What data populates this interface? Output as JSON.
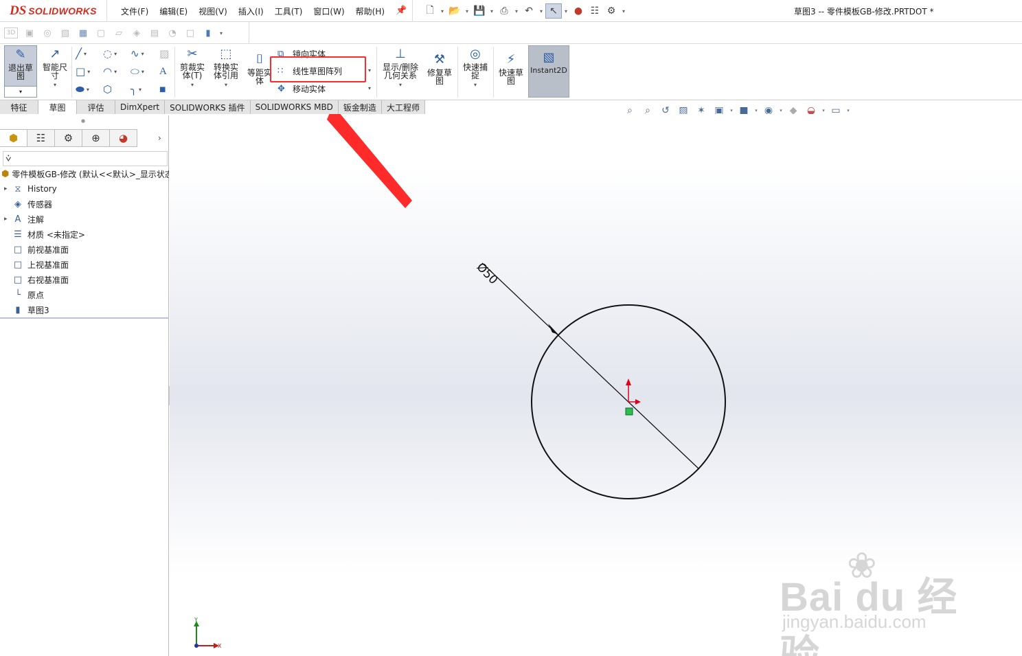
{
  "app": {
    "brand_ds": "DS",
    "brand_name": "SOLIDWORKS",
    "document_title": "草图3 -- 零件模板GB-修改.PRTDOT *"
  },
  "menu": [
    "文件(F)",
    "编辑(E)",
    "视图(V)",
    "插入(I)",
    "工具(T)",
    "窗口(W)",
    "帮助(H)"
  ],
  "ribbon": {
    "exit_sketch": "退出草图",
    "smart_dim": "智能尺寸",
    "trim": "剪裁实体(T)",
    "convert": "转换实体引用",
    "offset": "等距实体",
    "mirror": "镜向实体",
    "linear_pattern": "线性草图阵列",
    "move": "移动实体",
    "display_relations": "显示/删除几何关系",
    "repair": "修复草图",
    "quick_snap": "快速捕捉",
    "rapid_sketch": "快速草图",
    "instant2d": "Instant2D"
  },
  "tabs": [
    "特征",
    "草图",
    "评估",
    "DimXpert",
    "SOLIDWORKS 插件",
    "SOLIDWORKS MBD",
    "钣金制造",
    "大工程师"
  ],
  "active_tab": "草图",
  "tree": {
    "root": "零件模板GB-修改  (默认<<默认>_显示状态",
    "items": [
      {
        "label": "History",
        "icon": "history-icon",
        "expandable": true
      },
      {
        "label": "传感器",
        "icon": "sensor-icon",
        "expandable": false
      },
      {
        "label": "注解",
        "icon": "annotation-icon",
        "expandable": true
      },
      {
        "label": "材质 <未指定>",
        "icon": "material-icon",
        "expandable": false
      },
      {
        "label": "前视基准面",
        "icon": "plane-icon",
        "expandable": false
      },
      {
        "label": "上视基准面",
        "icon": "plane-icon",
        "expandable": false
      },
      {
        "label": "右视基准面",
        "icon": "plane-icon",
        "expandable": false
      },
      {
        "label": "原点",
        "icon": "origin-icon",
        "expandable": false
      },
      {
        "label": "草图3",
        "icon": "sketch-icon",
        "expandable": false
      }
    ]
  },
  "canvas": {
    "dimension_label": "Ø50",
    "axis_y": "Y",
    "axis_x": "X"
  },
  "watermark": {
    "text": "Bai du 经验",
    "url": "jingyan.baidu.com"
  },
  "colors": {
    "brand_red": "#d52b1e",
    "highlight_red": "#ff2a2a",
    "origin_red": "#e0001a",
    "origin_green": "#2dbd4e"
  }
}
